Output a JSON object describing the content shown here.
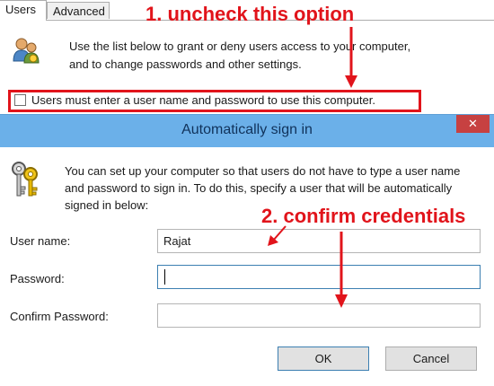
{
  "background_window": {
    "tabs": [
      {
        "label": "Users"
      },
      {
        "label": "Advanced"
      }
    ],
    "description": "Use the list below to grant or deny users access to your computer, and to change passwords and other settings.",
    "checkbox_label": "Users must enter a user name and password to use this computer.",
    "checkbox_checked": false
  },
  "annotations": {
    "step1": "1. uncheck this option",
    "step2": "2. confirm credentials",
    "color": "#e1141b"
  },
  "dialog": {
    "title": "Automatically sign in",
    "close_glyph": "✕",
    "description": "You can set up your computer so that users do not have to type a user name and password to sign in. To do this, specify a user that will be automatically signed in below:",
    "user_name_label": "User name:",
    "user_name_value": "Rajat",
    "password_label": "Password:",
    "password_value": "",
    "confirm_label": "Confirm Password:",
    "confirm_value": "",
    "ok_label": "OK",
    "cancel_label": "Cancel",
    "title_bar_color": "#6bb0e9",
    "close_color": "#c74141"
  },
  "icons": {
    "users": "users-icon",
    "keys": "keys-icon",
    "close": "close-icon"
  }
}
